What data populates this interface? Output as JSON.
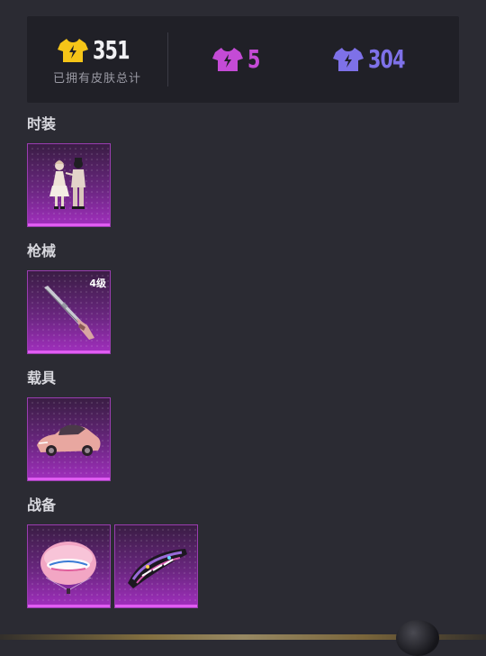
{
  "stats": {
    "total_count": "351",
    "total_label": "已拥有皮肤总计",
    "epic_count": "5",
    "rare_count": "304",
    "colors": {
      "legendary": "#f5c518",
      "epic": "#c44bd6",
      "rare": "#7e71e8"
    },
    "icons": {
      "total": "shirt-lightning-icon-gold",
      "epic": "shirt-lightning-icon-purple",
      "rare": "shirt-lightning-icon-blue"
    }
  },
  "sections": [
    {
      "title": "时装",
      "items": [
        {
          "icon": "couple-outfit-icon",
          "badge": ""
        }
      ]
    },
    {
      "title": "枪械",
      "items": [
        {
          "icon": "rifle-icon",
          "badge": "4级"
        }
      ]
    },
    {
      "title": "载具",
      "items": [
        {
          "icon": "sports-car-icon",
          "badge": ""
        }
      ]
    },
    {
      "title": "战备",
      "items": [
        {
          "icon": "parachute-icon",
          "badge": ""
        },
        {
          "icon": "glider-icon",
          "badge": ""
        }
      ]
    }
  ]
}
